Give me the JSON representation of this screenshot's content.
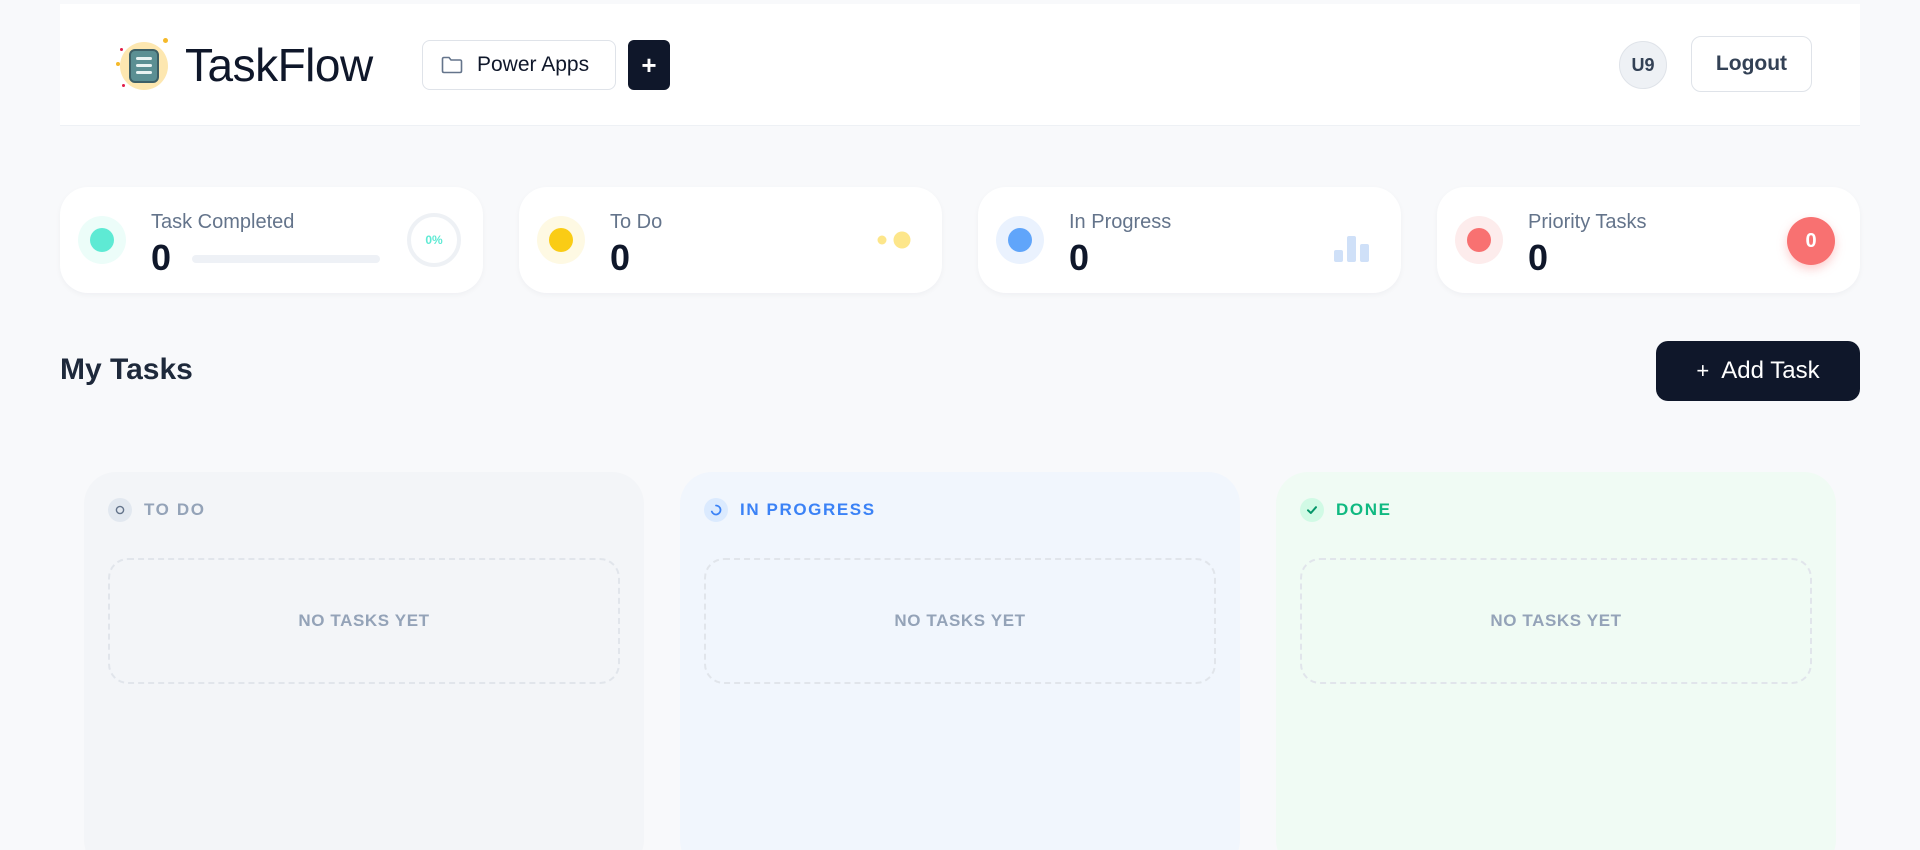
{
  "header": {
    "brand": "TaskFlow",
    "project_label": "Power Apps",
    "add_project_label": "+",
    "avatar_initials": "U9",
    "logout_label": "Logout"
  },
  "stats": {
    "completed": {
      "label": "Task Completed",
      "value": "0",
      "percent_label": "0%",
      "progress": 0,
      "color": "#5eead4"
    },
    "todo": {
      "label": "To Do",
      "value": "0",
      "color": "#facc15"
    },
    "in_progress": {
      "label": "In Progress",
      "value": "0",
      "color": "#60a5fa"
    },
    "priority": {
      "label": "Priority Tasks",
      "value": "0",
      "badge": "0",
      "color": "#f87171"
    }
  },
  "section": {
    "title": "My Tasks",
    "add_task_plus": "+",
    "add_task_label": "Add Task"
  },
  "columns": [
    {
      "title": "TO DO",
      "empty": "NO TASKS YET",
      "color": "#94a3b8"
    },
    {
      "title": "IN PROGRESS",
      "empty": "NO TASKS YET",
      "color": "#3b82f6"
    },
    {
      "title": "DONE",
      "empty": "NO TASKS YET",
      "color": "#10b981"
    }
  ]
}
